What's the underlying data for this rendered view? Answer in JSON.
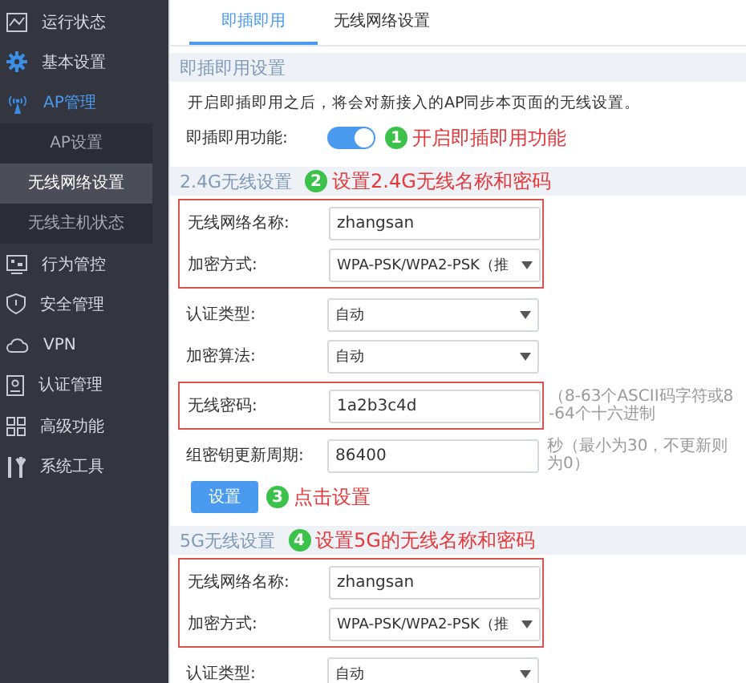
{
  "sidebar": {
    "items": [
      {
        "label": "运行状态",
        "selected": false
      },
      {
        "label": "基本设置",
        "selected": false
      },
      {
        "label": "AP管理",
        "selected": true,
        "children": [
          {
            "label": "AP设置",
            "selected": false
          },
          {
            "label": "无线网络设置",
            "selected": true
          },
          {
            "label": "无线主机状态",
            "selected": false
          }
        ]
      },
      {
        "label": "行为管控",
        "selected": false
      },
      {
        "label": "安全管理",
        "selected": false
      },
      {
        "label": "VPN",
        "selected": false
      },
      {
        "label": "认证管理",
        "selected": false
      },
      {
        "label": "高级功能",
        "selected": false
      },
      {
        "label": "系统工具",
        "selected": false
      }
    ]
  },
  "tabs": [
    {
      "label": "即插即用",
      "selected": true
    },
    {
      "label": "无线网络设置",
      "selected": false
    }
  ],
  "sections": [
    {
      "title": "即插即用设置",
      "blocks": [
        {
          "outlined": false,
          "rows": [
            {
              "kind": "note",
              "text": "开启即插即用之后，将会对新接入的AP同步本页面的无线设置。"
            },
            {
              "kind": "toggle",
              "label": "即插即用功能:",
              "on": true,
              "annotation": {
                "number": "1",
                "text": "开启即插即用功能"
              }
            }
          ]
        }
      ]
    },
    {
      "title": "2.4G无线设置",
      "annotation": {
        "number": "2",
        "text": "设置2.4G无线名称和密码"
      },
      "blocks": [
        {
          "outlined": true,
          "rows": [
            {
              "kind": "text",
              "label": "无线网络名称:",
              "value": "zhangsan"
            },
            {
              "kind": "select",
              "label": "加密方式:",
              "value": "WPA-PSK/WPA2-PSK（推"
            }
          ]
        },
        {
          "outlined": false,
          "rows": [
            {
              "kind": "select",
              "label": "认证类型:",
              "value": "自动"
            },
            {
              "kind": "select",
              "label": "加密算法:",
              "value": "自动"
            }
          ]
        },
        {
          "outlined": true,
          "rows": [
            {
              "kind": "text",
              "label": "无线密码:",
              "value": "1a2b3c4d",
              "hint": "（8-63个ASCII码字符或8-64个十六进制"
            }
          ]
        },
        {
          "outlined": false,
          "rows": [
            {
              "kind": "text",
              "label": "组密钥更新周期:",
              "value": "86400",
              "hint": "秒（最小为30，不更新则为0）"
            },
            {
              "kind": "button",
              "text": "设置",
              "annotation": {
                "number": "3",
                "text": "点击设置"
              }
            }
          ]
        }
      ]
    },
    {
      "title": "5G无线设置",
      "annotation": {
        "number": "4",
        "text": "设置5G的无线名称和密码"
      },
      "blocks": [
        {
          "outlined": true,
          "rows": [
            {
              "kind": "text",
              "label": "无线网络名称:",
              "value": "zhangsan"
            },
            {
              "kind": "select",
              "label": "加密方式:",
              "value": "WPA-PSK/WPA2-PSK（推"
            }
          ]
        },
        {
          "outlined": false,
          "rows": [
            {
              "kind": "select",
              "label": "认证类型:",
              "value": "自动"
            }
          ]
        }
      ]
    }
  ]
}
